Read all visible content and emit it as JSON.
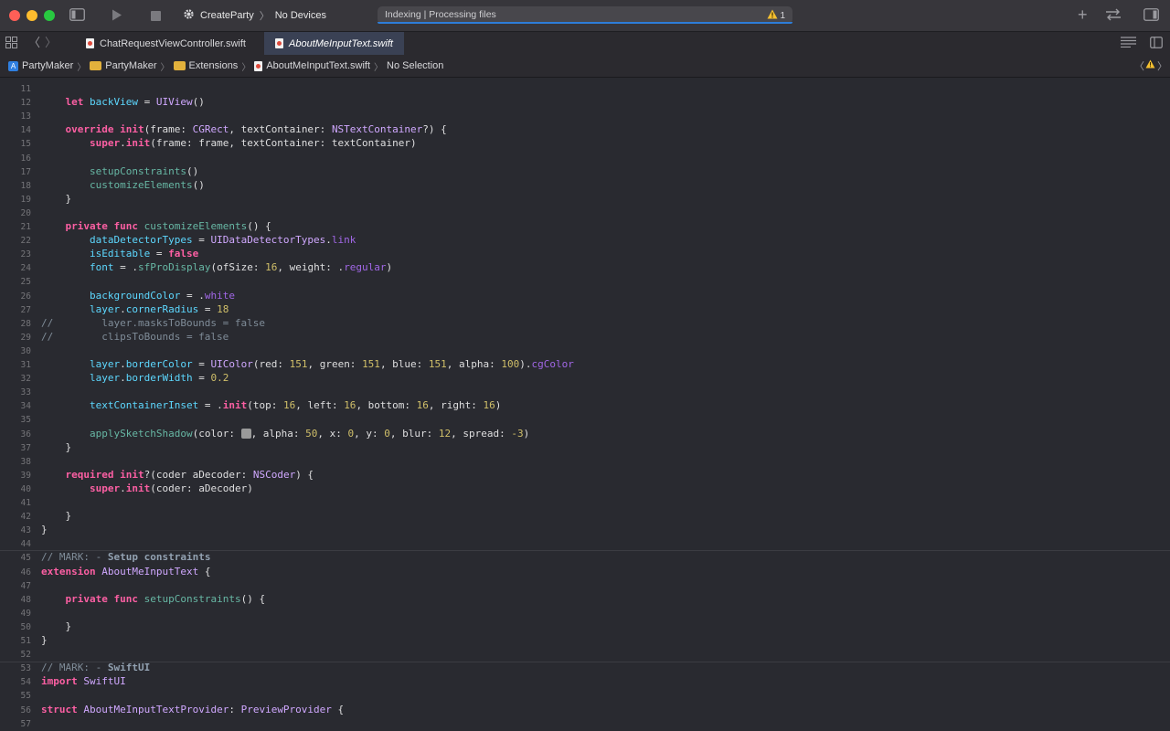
{
  "toolbar": {
    "scheme_project": "CreateParty",
    "scheme_destination": "No Devices",
    "activity_text": "Indexing | Processing files",
    "warning_count": "1"
  },
  "tabs": [
    {
      "label": "ChatRequestViewController.swift",
      "active": false
    },
    {
      "label": "AboutMeInputText.swift",
      "active": true
    }
  ],
  "jumpbar": {
    "project": "PartyMaker",
    "group": "PartyMaker",
    "folder": "Extensions",
    "file": "AboutMeInputText.swift",
    "selection": "No Selection"
  },
  "code_lines": [
    {
      "n": "11",
      "src": ""
    },
    {
      "n": "12",
      "src": "    let backView = UIView()"
    },
    {
      "n": "13",
      "src": ""
    },
    {
      "n": "14",
      "src": "    override init(frame: CGRect, textContainer: NSTextContainer?) {"
    },
    {
      "n": "15",
      "src": "        super.init(frame: frame, textContainer: textContainer)"
    },
    {
      "n": "16",
      "src": ""
    },
    {
      "n": "17",
      "src": "        setupConstraints()"
    },
    {
      "n": "18",
      "src": "        customizeElements()"
    },
    {
      "n": "19",
      "src": "    }"
    },
    {
      "n": "20",
      "src": ""
    },
    {
      "n": "21",
      "src": "    private func customizeElements() {"
    },
    {
      "n": "22",
      "src": "        dataDetectorTypes = UIDataDetectorTypes.link"
    },
    {
      "n": "23",
      "src": "        isEditable = false"
    },
    {
      "n": "24",
      "src": "        font = .sfProDisplay(ofSize: 16, weight: .regular)"
    },
    {
      "n": "25",
      "src": ""
    },
    {
      "n": "26",
      "src": "        backgroundColor = .white"
    },
    {
      "n": "27",
      "src": "        layer.cornerRadius = 18"
    },
    {
      "n": "28",
      "src": "//        layer.masksToBounds = false"
    },
    {
      "n": "29",
      "src": "//        clipsToBounds = false"
    },
    {
      "n": "30",
      "src": ""
    },
    {
      "n": "31",
      "src": "        layer.borderColor = UIColor(red: 151, green: 151, blue: 151, alpha: 100).cgColor"
    },
    {
      "n": "32",
      "src": "        layer.borderWidth = 0.2"
    },
    {
      "n": "33",
      "src": ""
    },
    {
      "n": "34",
      "src": "        textContainerInset = .init(top: 16, left: 16, bottom: 16, right: 16)"
    },
    {
      "n": "35",
      "src": ""
    },
    {
      "n": "36",
      "src": "        applySketchShadow(color: [swatch], alpha: 50, x: 0, y: 0, blur: 12, spread: -3)"
    },
    {
      "n": "37",
      "src": "    }"
    },
    {
      "n": "38",
      "src": ""
    },
    {
      "n": "39",
      "src": "    required init?(coder aDecoder: NSCoder) {"
    },
    {
      "n": "40",
      "src": "        super.init(coder: aDecoder)"
    },
    {
      "n": "41",
      "src": ""
    },
    {
      "n": "42",
      "src": "    }"
    },
    {
      "n": "43",
      "src": "}"
    },
    {
      "n": "44",
      "src": ""
    },
    {
      "n": "45",
      "src": "// MARK: - Setup constraints"
    },
    {
      "n": "46",
      "src": "extension AboutMeInputText {"
    },
    {
      "n": "47",
      "src": ""
    },
    {
      "n": "48",
      "src": "    private func setupConstraints() {"
    },
    {
      "n": "49",
      "src": ""
    },
    {
      "n": "50",
      "src": "    }"
    },
    {
      "n": "51",
      "src": "}"
    },
    {
      "n": "52",
      "src": ""
    },
    {
      "n": "53",
      "src": "// MARK: - SwiftUI"
    },
    {
      "n": "54",
      "src": "import SwiftUI"
    },
    {
      "n": "55",
      "src": ""
    },
    {
      "n": "56",
      "src": "struct AboutMeInputTextProvider: PreviewProvider {"
    },
    {
      "n": "57",
      "src": ""
    }
  ],
  "colors": {
    "keyword": "#fc5fa3",
    "type": "#d0a8ff",
    "project_symbol": "#67b7a4",
    "property": "#5dd8ff",
    "number": "#d0bf69",
    "comment": "#7f8c98",
    "editor_bg": "#292a30",
    "accent": "#2d7dd9"
  }
}
